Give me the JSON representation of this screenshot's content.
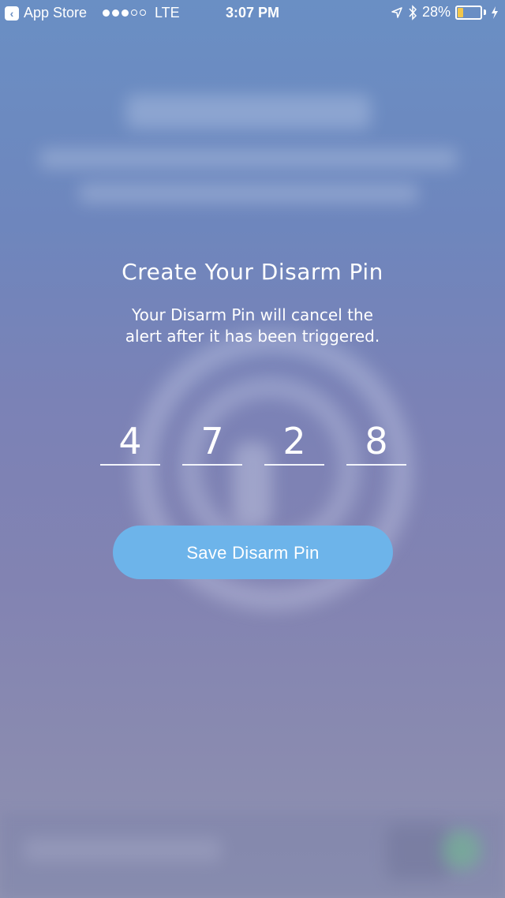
{
  "status_bar": {
    "back_app_label": "App Store",
    "carrier": "LTE",
    "time": "3:07 PM",
    "battery_text": "28%",
    "battery_level": 0.28,
    "signal_bars_filled": 3,
    "signal_bars_total": 5,
    "icons": [
      "back-arrow-icon",
      "location-icon",
      "bluetooth-icon",
      "battery-icon",
      "charging-bolt-icon"
    ]
  },
  "main": {
    "title": "Create Your Disarm Pin",
    "subtitle_line1": "Your Disarm Pin will cancel the",
    "subtitle_line2": "alert after it has been triggered.",
    "pin_digits": [
      "4",
      "7",
      "2",
      "8"
    ],
    "save_button_label": "Save Disarm Pin"
  },
  "colors": {
    "accent_button": "#6db4ea",
    "background_top": "#6a8fc4",
    "background_bottom": "#8f93b2",
    "battery_fill": "#f3c64a"
  }
}
